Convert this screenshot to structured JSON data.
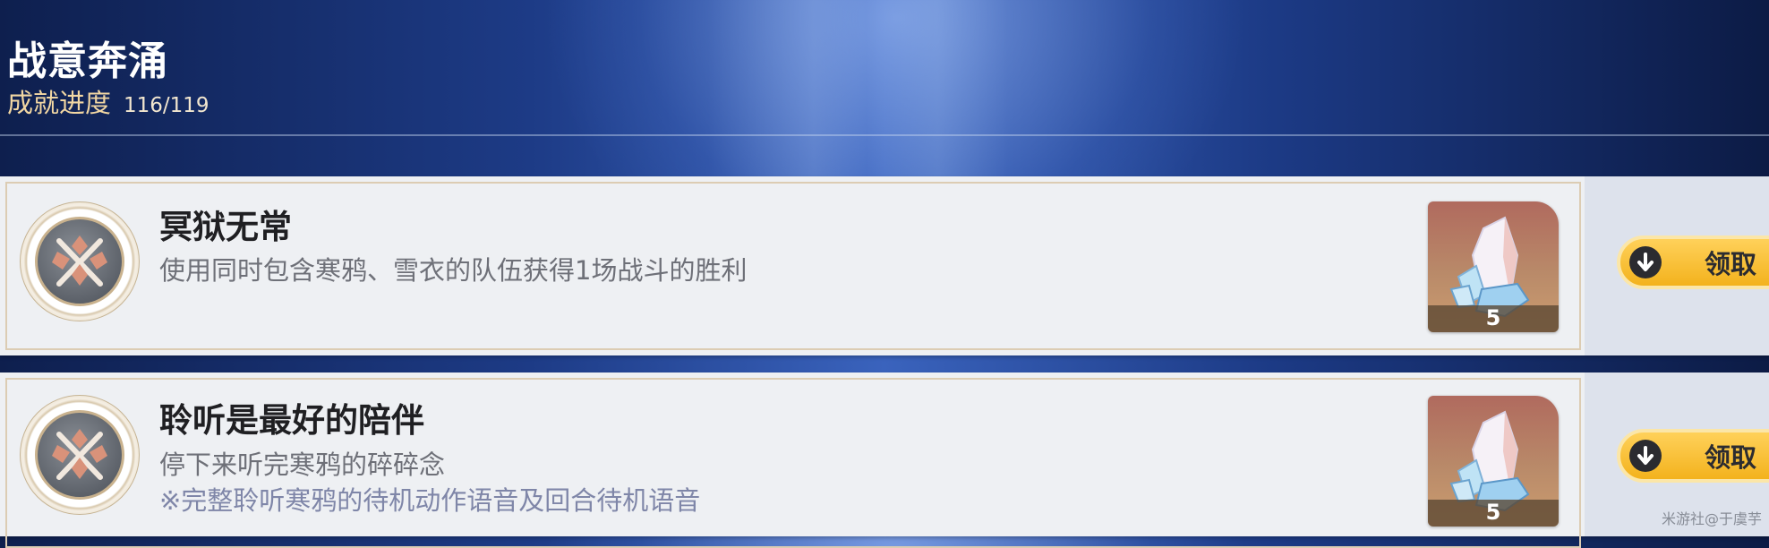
{
  "header": {
    "title": "战意奔涌",
    "progress_label": "成就进度",
    "progress_count": "116/119"
  },
  "achievements": [
    {
      "title": "冥狱无常",
      "description": "使用同时包含寒鸦、雪衣的队伍获得1场战斗的胜利",
      "reward_count": "5",
      "claim_label": "领取"
    },
    {
      "title": "聆听是最好的陪伴",
      "description": "停下来听完寒鸦的碎碎念",
      "note": "※完整聆听寒鸦的待机动作语音及回合待机语音",
      "reward_count": "5",
      "claim_label": "领取"
    }
  ],
  "watermark": "米游社@于虞芋",
  "colors": {
    "claim_button": "#f3b21d",
    "progress_label": "#f2d7a3",
    "card_background": "#eef0f3"
  },
  "icons": {
    "badge": "crossed-axes-emblem-icon",
    "reward": "crystal-icon",
    "claim": "download-arrow-icon"
  }
}
